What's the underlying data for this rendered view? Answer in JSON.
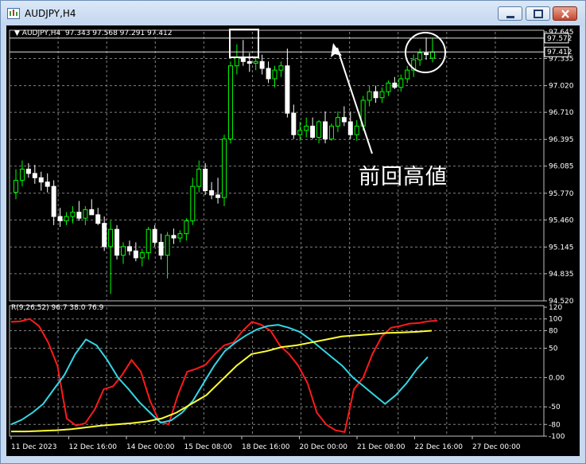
{
  "window": {
    "title": "AUDJPY,H4",
    "controls": [
      "minimize-icon",
      "maximize-icon",
      "close-icon"
    ]
  },
  "chart": {
    "info_label": "AUDJPY,H4",
    "ohlc": "97.343 97.568 97.291 97.412",
    "indicator_label": "R(9,26,52)",
    "indicator_values": "96.7 38.0 76.9",
    "annotation": "前回高値",
    "price_levels": [
      "97.645",
      "97.335",
      "97.020",
      "96.710",
      "96.395",
      "96.085",
      "95.770",
      "95.460",
      "95.145",
      "94.835",
      "94.520"
    ],
    "highlight_prices": [
      "97.572",
      "97.412"
    ],
    "indicator_levels": [
      "120",
      "100",
      "80",
      "50",
      "0.00",
      "-50",
      "-80",
      "-100"
    ],
    "time_labels": [
      "11 Dec 2023",
      "12 Dec 16:00",
      "14 Dec 00:00",
      "15 Dec 08:00",
      "18 Dec 16:00",
      "20 Dec 00:00",
      "21 Dec 08:00",
      "22 Dec 16:00",
      "27 Dec 00:00"
    ],
    "colors": {
      "background": "#000000",
      "grid": "#808080",
      "bull_candle": "#00ff00",
      "bear_candle": "#ffffff",
      "line_red": "#ff1a1a",
      "line_cyan": "#33d6e6",
      "line_yellow": "#ffff33",
      "annotation": "#ffffff"
    }
  },
  "chart_data": {
    "type": "candlestick",
    "symbol": "AUDJPY",
    "timeframe": "H4",
    "ylim": [
      94.52,
      97.645
    ],
    "candles": [
      [
        95.78,
        96.05,
        95.7,
        95.92
      ],
      [
        95.92,
        96.15,
        95.85,
        96.05
      ],
      [
        96.05,
        96.12,
        95.95,
        96.0
      ],
      [
        96.0,
        96.1,
        95.88,
        95.95
      ],
      [
        95.95,
        96.02,
        95.8,
        95.9
      ],
      [
        95.9,
        96.0,
        95.78,
        95.85
      ],
      [
        95.85,
        95.92,
        95.4,
        95.5
      ],
      [
        95.5,
        95.6,
        95.38,
        95.45
      ],
      [
        95.45,
        95.55,
        95.4,
        95.5
      ],
      [
        95.5,
        95.62,
        95.42,
        95.55
      ],
      [
        95.55,
        95.68,
        95.45,
        95.48
      ],
      [
        95.48,
        95.62,
        95.4,
        95.58
      ],
      [
        95.58,
        95.7,
        95.52,
        95.52
      ],
      [
        95.52,
        95.6,
        95.4,
        95.42
      ],
      [
        95.42,
        95.5,
        95.1,
        95.15
      ],
      [
        95.15,
        95.45,
        94.6,
        95.35
      ],
      [
        95.35,
        95.4,
        95.0,
        95.05
      ],
      [
        95.05,
        95.2,
        94.95,
        95.15
      ],
      [
        95.15,
        95.22,
        95.05,
        95.1
      ],
      [
        95.1,
        95.2,
        94.98,
        95.02
      ],
      [
        95.02,
        95.12,
        94.92,
        95.08
      ],
      [
        95.08,
        95.38,
        95.0,
        95.35
      ],
      [
        95.35,
        95.4,
        95.15,
        95.2
      ],
      [
        95.2,
        95.3,
        95.0,
        95.05
      ],
      [
        95.05,
        95.32,
        94.78,
        95.28
      ],
      [
        95.28,
        95.36,
        95.18,
        95.25
      ],
      [
        95.25,
        95.34,
        95.2,
        95.3
      ],
      [
        95.3,
        95.48,
        95.22,
        95.45
      ],
      [
        95.45,
        95.95,
        95.4,
        95.85
      ],
      [
        95.85,
        96.15,
        95.78,
        96.05
      ],
      [
        96.05,
        96.12,
        95.75,
        95.8
      ],
      [
        95.8,
        95.9,
        95.7,
        95.75
      ],
      [
        95.75,
        95.95,
        95.65,
        95.72
      ],
      [
        95.72,
        96.45,
        95.62,
        96.4
      ],
      [
        96.4,
        97.3,
        96.35,
        97.25
      ],
      [
        97.25,
        97.5,
        97.15,
        97.35
      ],
      [
        97.35,
        97.55,
        97.25,
        97.3
      ],
      [
        97.3,
        97.4,
        97.18,
        97.28
      ],
      [
        97.28,
        97.35,
        97.2,
        97.3
      ],
      [
        97.3,
        97.38,
        97.15,
        97.22
      ],
      [
        97.22,
        97.3,
        97.05,
        97.1
      ],
      [
        97.1,
        97.25,
        97.0,
        97.2
      ],
      [
        97.2,
        97.3,
        97.12,
        97.25
      ],
      [
        97.25,
        97.45,
        96.65,
        96.7
      ],
      [
        96.7,
        96.8,
        96.4,
        96.45
      ],
      [
        96.45,
        96.6,
        96.38,
        96.5
      ],
      [
        96.5,
        96.65,
        96.42,
        96.55
      ],
      [
        96.55,
        96.65,
        96.4,
        96.42
      ],
      [
        96.42,
        96.62,
        96.35,
        96.6
      ],
      [
        96.6,
        96.72,
        96.35,
        96.4
      ],
      [
        96.4,
        96.58,
        96.38,
        96.55
      ],
      [
        96.55,
        96.72,
        96.48,
        96.65
      ],
      [
        96.65,
        96.78,
        96.55,
        96.6
      ],
      [
        96.6,
        96.72,
        96.4,
        96.45
      ],
      [
        96.45,
        96.62,
        96.38,
        96.55
      ],
      [
        96.55,
        96.9,
        96.5,
        96.85
      ],
      [
        96.85,
        97.02,
        96.78,
        96.95
      ],
      [
        96.95,
        97.02,
        96.82,
        96.88
      ],
      [
        96.88,
        97.0,
        96.82,
        96.95
      ],
      [
        96.95,
        97.08,
        96.9,
        97.05
      ],
      [
        97.05,
        97.12,
        96.98,
        97.0
      ],
      [
        97.0,
        97.15,
        96.95,
        97.1
      ],
      [
        97.1,
        97.25,
        97.05,
        97.2
      ],
      [
        97.2,
        97.38,
        97.12,
        97.32
      ],
      [
        97.32,
        97.45,
        97.25,
        97.4
      ],
      [
        97.4,
        97.58,
        97.32,
        97.38
      ],
      [
        97.34,
        97.57,
        97.29,
        97.41
      ]
    ],
    "indicator": {
      "name": "R(9,26,52)",
      "ylim": [
        -100,
        120
      ],
      "series": [
        {
          "color": "red",
          "values": [
            95,
            96,
            100,
            88,
            60,
            20,
            -70,
            -82,
            -78,
            -55,
            -20,
            -15,
            5,
            30,
            10,
            -40,
            -75,
            -80,
            -30,
            10,
            15,
            22,
            40,
            55,
            60,
            80,
            95,
            90,
            80,
            55,
            40,
            20,
            -10,
            -60,
            -80,
            -90,
            -93,
            -20,
            0,
            40,
            70,
            85,
            88,
            92,
            93,
            96,
            97
          ]
        },
        {
          "color": "cyan",
          "values": [
            -80,
            -72,
            -60,
            -45,
            -20,
            5,
            40,
            65,
            55,
            30,
            0,
            -20,
            -42,
            -60,
            -77,
            -73,
            -60,
            -40,
            -10,
            20,
            45,
            60,
            72,
            82,
            88,
            90,
            85,
            78,
            65,
            50,
            35,
            20,
            0,
            -15,
            -30,
            -45,
            -30,
            -10,
            15,
            35
          ]
        },
        {
          "color": "yellow",
          "values": [
            -92,
            -92,
            -91,
            -90,
            -88,
            -85,
            -82,
            -80,
            -78,
            -75,
            -70,
            -60,
            -45,
            -30,
            -5,
            20,
            40,
            45,
            52,
            55,
            60,
            65,
            70,
            72,
            74,
            76,
            77,
            78,
            80
          ]
        }
      ]
    }
  }
}
